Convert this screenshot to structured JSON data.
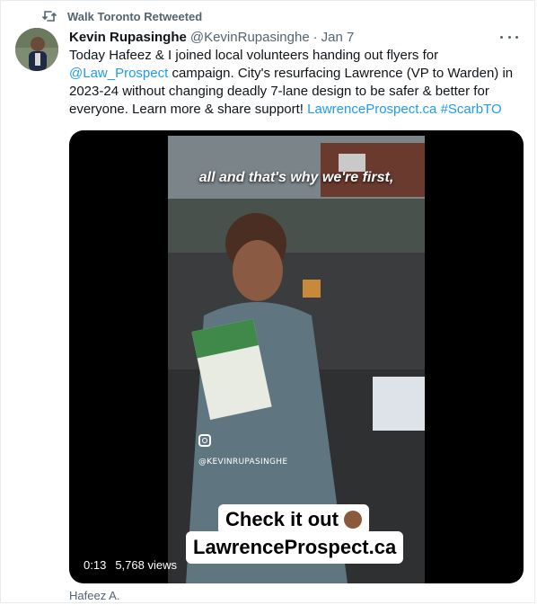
{
  "retweet": {
    "text": "Walk Toronto Retweeted"
  },
  "author": {
    "name": "Kevin Rupasinghe",
    "handle": "@KevinRupasinghe",
    "dot": "·",
    "date": "Jan 7"
  },
  "tweet": {
    "line1": "Today Hafeez & I joined local volunteers handing out flyers for",
    "mention": "@Law_Prospect",
    "line2_rest": " campaign. City's resurfacing Lawrence (VP to Warden) in",
    "line3": "2023-24 without changing deadly 7-lane design to be safer & better for",
    "line4_start": "everyone. Learn more & share support! ",
    "url_link": "LawrenceProspect.ca",
    "hashtag": "#ScarbTO"
  },
  "video": {
    "caption_top": "all and that's why we're first,",
    "ig_handle": "@KEVINRUPASINGHE",
    "cta_line1": "Check it out",
    "cta_line2": "LawrenceProspect.ca",
    "time": "0:13",
    "views": "5,768 views"
  },
  "attribution": "Hafeez A.",
  "colors": {
    "link": "#1d9bf0",
    "secondary_text": "#536471",
    "media_bg": "#000000"
  },
  "icons": {
    "retweet": "retweet-icon",
    "more": "more-icon",
    "instagram": "instagram-icon"
  }
}
